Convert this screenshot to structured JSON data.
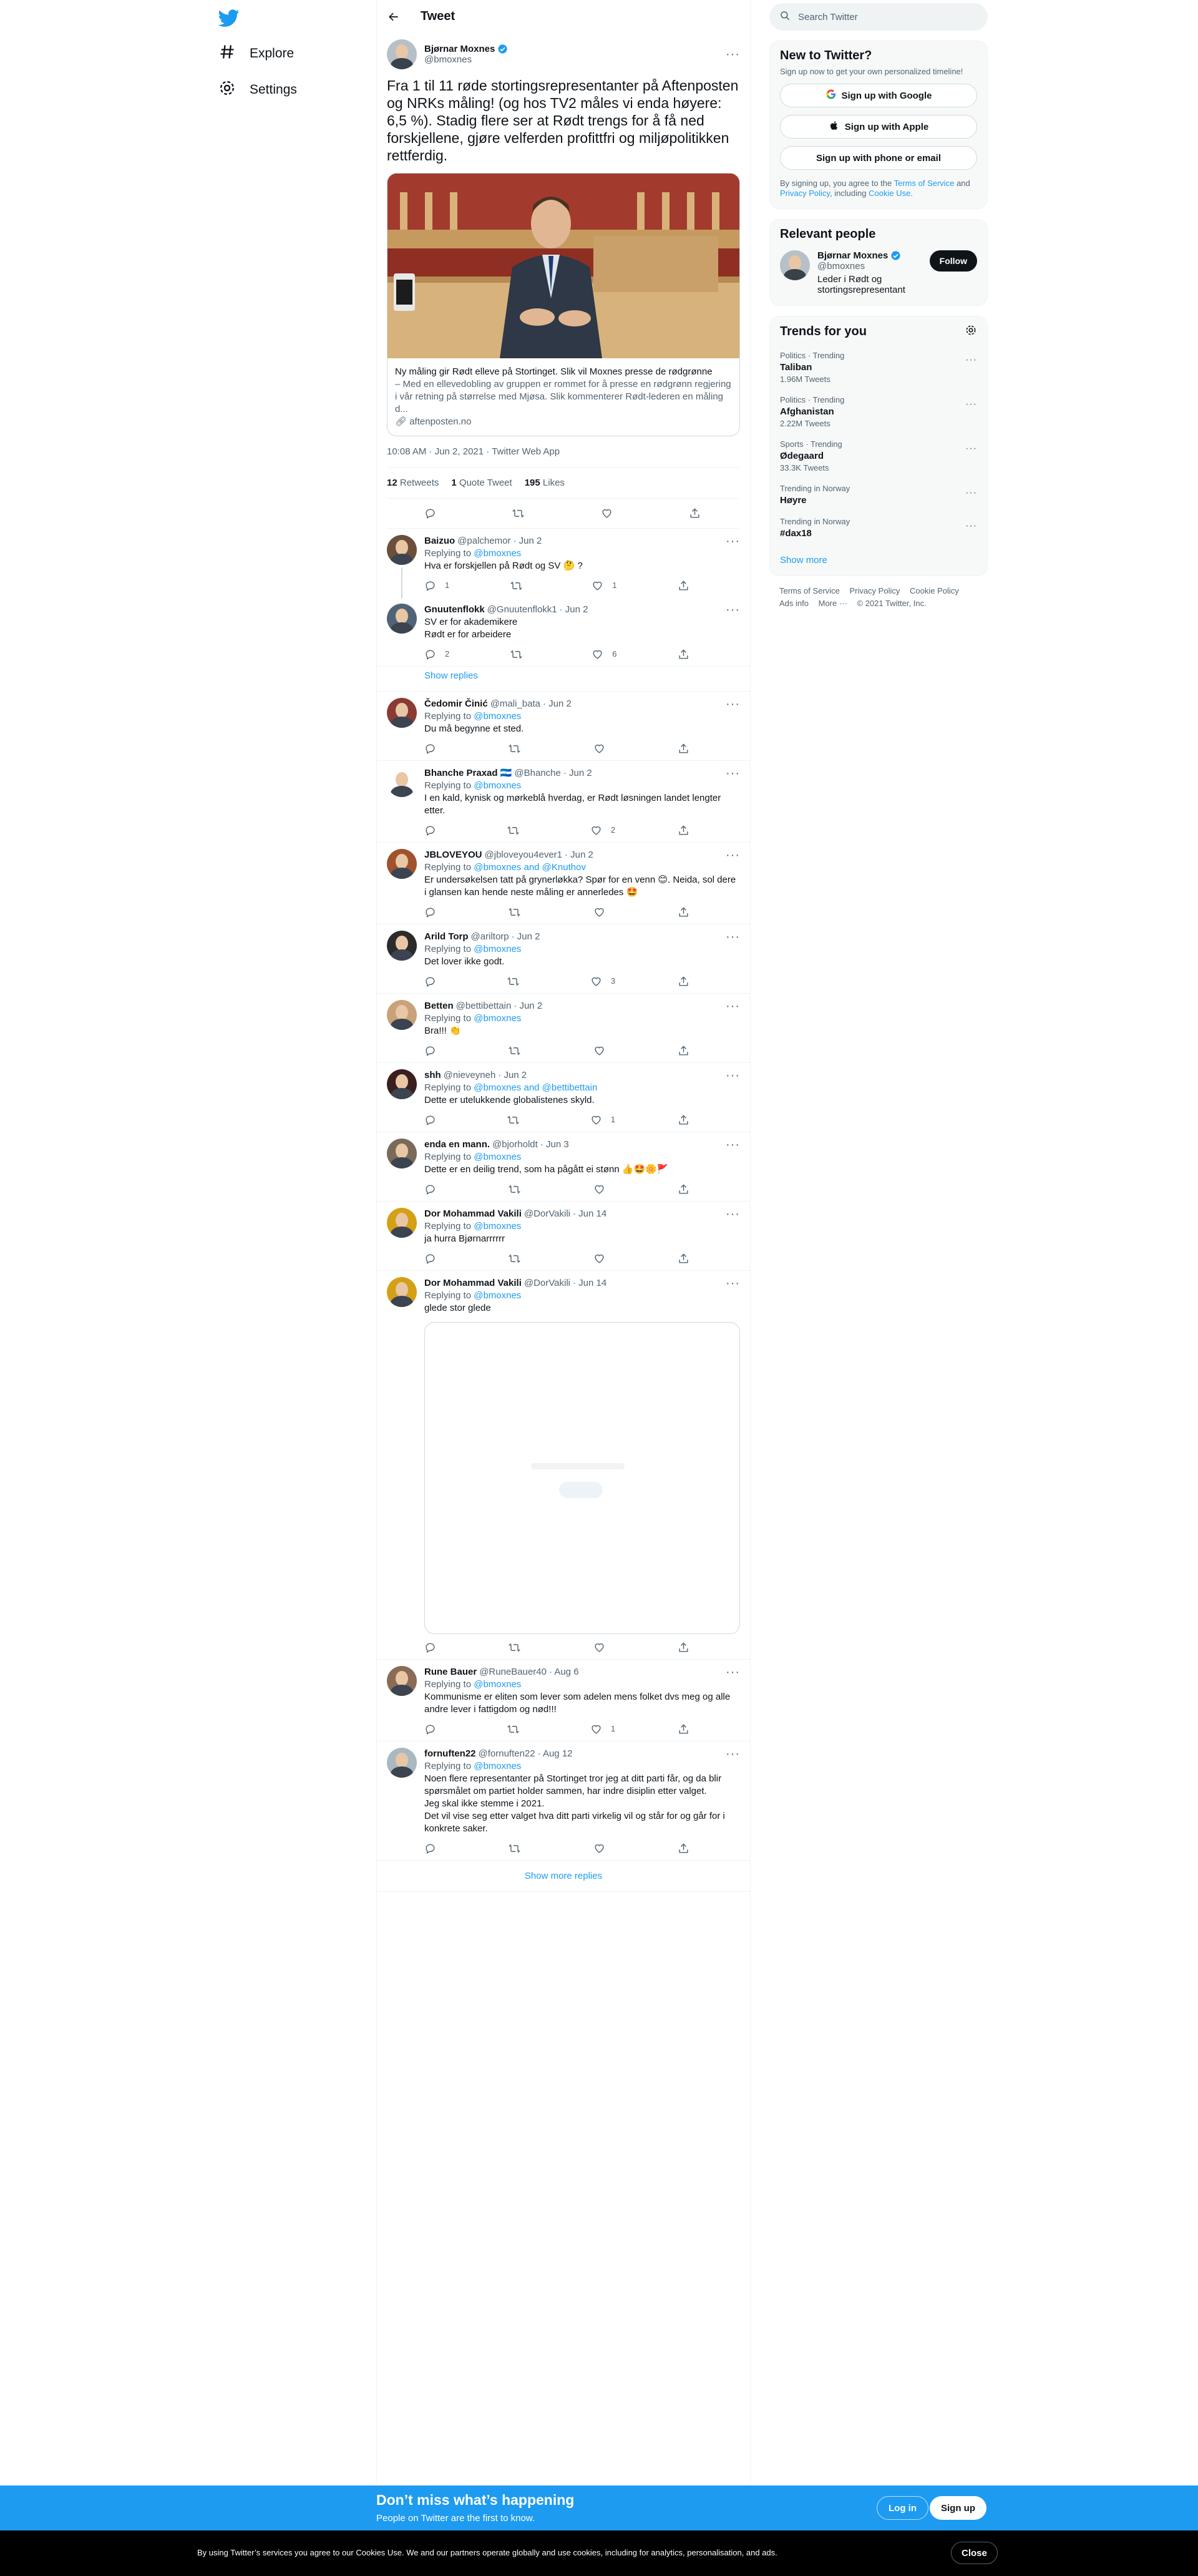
{
  "nav": {
    "items": [
      {
        "label": "Explore",
        "icon": "hashtag-icon"
      },
      {
        "label": "Settings",
        "icon": "gear-icon"
      }
    ]
  },
  "header": {
    "title": "Tweet"
  },
  "tweet": {
    "name": "Bjørnar Moxnes",
    "handle": "@bmoxnes",
    "text": "Fra 1 til 11 røde stortingsrepresentanter på Aftenposten og NRKs måling! (og hos TV2 måles vi enda høyere: 6,5 %). Stadig flere ser at Rødt trengs for å få ned forskjellene, gjøre velferden profittfri og miljøpolitikken rettferdig.",
    "card": {
      "title": "Ny måling gir Rødt elleve på Stortinget. Slik vil Moxnes presse de rødgrønne",
      "description": "– Med en ellevedobling av gruppen er rommet for å presse en rødgrønn regjering i vår retning på størrelse med Mjøsa. Slik kommenterer Rødt-lederen en måling d...",
      "domain": "aftenposten.no"
    },
    "meta": "10:08 AM · Jun 2, 2021 · Twitter Web App",
    "retweets": "12",
    "retweets_label": "Retweets",
    "quotes": "1",
    "quotes_label": "Quote Tweet",
    "likes": "195",
    "likes_label": "Likes"
  },
  "replies": [
    {
      "name": "Baizuo",
      "handle": "@palchemor",
      "date": "· Jun 2",
      "to_prefix": "Replying to",
      "to": "@bmoxnes",
      "text": "Hva er forskjellen på Rødt og SV 🤔 ?",
      "reply_count": "1",
      "retweet_count": "",
      "like_count": "1"
    },
    {
      "name": "Gnuutenflokk",
      "handle": "@Gnuutenflokk1",
      "date": "· Jun 2",
      "to_prefix": "",
      "to": "",
      "text": "SV er for akademikere\nRødt er for arbeidere",
      "reply_count": "2",
      "retweet_count": "",
      "like_count": "6"
    },
    {
      "name": "Čedomir Činić",
      "handle": "@mali_bata",
      "date": "· Jun 2",
      "to_prefix": "Replying to",
      "to": "@bmoxnes",
      "text": "Du må begynne et sted.",
      "reply_count": "",
      "retweet_count": "",
      "like_count": ""
    },
    {
      "name": "Bhanche Praxad 🇳🇮",
      "handle": "@Bhanche",
      "date": "· Jun 2",
      "to_prefix": "Replying to",
      "to": "@bmoxnes",
      "text": "I en kald, kynisk og mørkeblå hverdag, er Rødt løsningen landet lengter etter.",
      "reply_count": "",
      "retweet_count": "",
      "like_count": "2"
    },
    {
      "name": "JBLOVEYOU",
      "handle": "@jbloveyou4ever1",
      "date": "· Jun 2",
      "to_prefix": "Replying to",
      "to": "@bmoxnes and @Knuthov",
      "text": "Er undersøkelsen tatt på grynerløkka? Spør for en venn 😊. Neida, sol dere i glansen kan hende neste måling er annerledes 🤩",
      "reply_count": "",
      "retweet_count": "",
      "like_count": ""
    },
    {
      "name": "Arild Torp",
      "handle": "@ariltorp",
      "date": "· Jun 2",
      "to_prefix": "Replying to",
      "to": "@bmoxnes",
      "text": "Det lover ikke godt.",
      "reply_count": "",
      "retweet_count": "",
      "like_count": "3"
    },
    {
      "name": "Betten",
      "handle": "@bettibettain",
      "date": "· Jun 2",
      "to_prefix": "Replying to",
      "to": "@bmoxnes",
      "text": "Bra!!! 👏",
      "reply_count": "",
      "retweet_count": "",
      "like_count": ""
    },
    {
      "name": "shh",
      "handle": "@nieveyneh",
      "date": "· Jun 2",
      "to_prefix": "Replying to",
      "to": "@bmoxnes and @bettibettain",
      "text": "Dette er utelukkende globalistenes skyld.",
      "reply_count": "",
      "retweet_count": "",
      "like_count": "1"
    },
    {
      "name": "enda en mann.",
      "handle": "@bjorholdt",
      "date": "· Jun 3",
      "to_prefix": "Replying to",
      "to": "@bmoxnes",
      "text": "Dette er en deilig trend, som ha pågått ei stønn 👍🤩🌼🚩",
      "reply_count": "",
      "retweet_count": "",
      "like_count": ""
    },
    {
      "name": "Dor Mohammad Vakili",
      "handle": "@DorVakili",
      "date": "· Jun 14",
      "to_prefix": "Replying to",
      "to": "@bmoxnes",
      "text": "ja hurra Bjørnarrrrrr",
      "reply_count": "",
      "retweet_count": "",
      "like_count": ""
    },
    {
      "name": "Dor Mohammad Vakili",
      "handle": "@DorVakili",
      "date": "· Jun 14",
      "to_prefix": "Replying to",
      "to": "@bmoxnes",
      "text": "glede stor glede",
      "reply_count": "",
      "retweet_count": "",
      "like_count": ""
    },
    {
      "name": "Rune Bauer",
      "handle": "@RuneBauer40",
      "date": "· Aug 6",
      "to_prefix": "Replying to",
      "to": "@bmoxnes",
      "text": "Kommunisme er eliten som lever som adelen mens folket dvs meg og alle andre lever i fattigdom og nød!!!",
      "reply_count": "",
      "retweet_count": "",
      "like_count": "1"
    },
    {
      "name": "fornuften22",
      "handle": "@fornuften22",
      "date": "· Aug 12",
      "to_prefix": "Replying to",
      "to": "@bmoxnes",
      "text": "Noen flere representanter på Stortinget tror jeg at ditt parti får, og da blir spørsmålet om partiet holder sammen, har indre disiplin etter valget.\nJeg skal ikke stemme i 2021.\nDet vil vise seg etter valget hva ditt parti virkelig vil og står for og går for i konkrete saker.",
      "reply_count": "",
      "retweet_count": "",
      "like_count": ""
    }
  ],
  "show_replies": "Show replies",
  "show_more_replies": "Show more replies",
  "sidebar": {
    "search_placeholder": "Search Twitter",
    "new_title": "New to Twitter?",
    "new_sub": "Sign up now to get your own personalized timeline!",
    "btn_google": "Sign up with Google",
    "btn_apple": "Sign up with Apple",
    "btn_phone": "Sign up with phone or email",
    "legal_pre": "By signing up, you agree to the",
    "legal_terms": "Terms of Service",
    "legal_and": "and",
    "legal_privacy": "Privacy Policy",
    "legal_mid": ", including",
    "legal_cookie": "Cookie Use.",
    "relevant_title": "Relevant people",
    "rp_name": "Bjørnar Moxnes",
    "rp_handle": "@bmoxnes",
    "rp_bio": "Leder i Rødt og stortingsrepresentant",
    "follow": "Follow",
    "trends_title": "Trends for you",
    "trends": [
      {
        "category": "Politics · Trending",
        "name": "Taliban",
        "count": "1.96M Tweets"
      },
      {
        "category": "Politics · Trending",
        "name": "Afghanistan",
        "count": "2.22M Tweets"
      },
      {
        "category": "Sports · Trending",
        "name": "Ødegaard",
        "count": "33.3K Tweets"
      },
      {
        "category": "Trending in Norway",
        "name": "Høyre",
        "count": ""
      },
      {
        "category": "Trending in Norway",
        "name": "#dax18",
        "count": ""
      }
    ],
    "show_more": "Show more",
    "footer": [
      "Terms of Service",
      "Privacy Policy",
      "Cookie Policy",
      "Ads info",
      "More ···",
      "© 2021 Twitter, Inc."
    ]
  },
  "bottom": {
    "title": "Don’t miss what’s happening",
    "sub": "People on Twitter are the first to know.",
    "login": "Log in",
    "signup": "Sign up"
  },
  "cookie": {
    "text": "By using Twitter’s services you agree to our Cookies Use. We and our partners operate globally and use cookies, including for analytics, personalisation, and ads.",
    "close": "Close"
  },
  "colors": {
    "accent": "#1d9bf0",
    "text": "#0f1419",
    "muted": "#536471",
    "border": "#eff3f4"
  }
}
